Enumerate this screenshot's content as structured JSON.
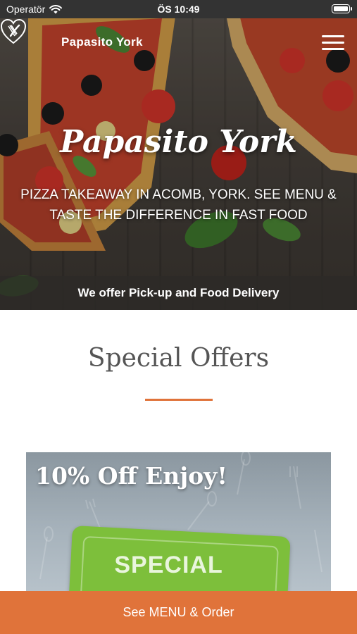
{
  "status_bar": {
    "carrier": "Operatör",
    "time": "ÖS 10:49"
  },
  "header": {
    "brand": "Papasito York",
    "logo_icon": "fork-knife-heart-icon",
    "menu_icon": "hamburger-menu-icon"
  },
  "hero": {
    "title": "Papasito York",
    "subtitle": "PIZZA TAKEAWAY IN ACOMB, YORK. SEE MENU & TASTE THE DIFFERENCE IN FAST FOOD",
    "banner": "We offer Pick-up and Food Delivery"
  },
  "special_offers": {
    "heading": "Special Offers",
    "card": {
      "title": "10% Off Enjoy!",
      "badge": "SPECIAL"
    }
  },
  "cta": {
    "label": "See MENU & Order"
  },
  "colors": {
    "accent": "#e0733a",
    "status_bar": "#333333",
    "band": "#2d2a28"
  }
}
